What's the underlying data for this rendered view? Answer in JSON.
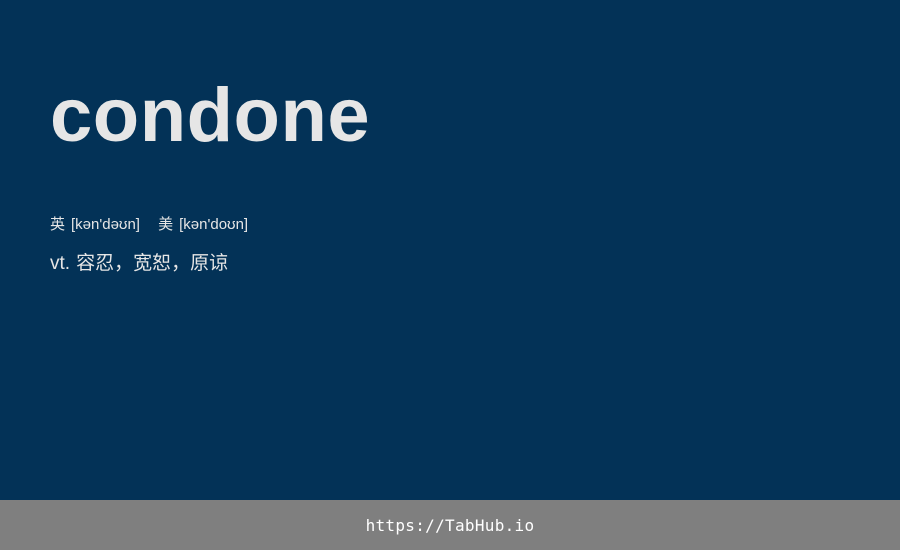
{
  "colors": {
    "background": "#033257",
    "text": "#e6e6e6",
    "footer_background": "#7f7f7f",
    "footer_text": "#ffffff"
  },
  "card": {
    "word": "condone",
    "phonetics": {
      "uk_label": "英",
      "uk_ipa": "[kən'dəʊn]",
      "us_label": "美",
      "us_ipa": "[kən'doʊn]"
    },
    "definition": {
      "part_of_speech": "vt.",
      "meaning": "容忍，宽恕，原谅"
    }
  },
  "footer": {
    "link_text": "https://TabHub.io"
  }
}
